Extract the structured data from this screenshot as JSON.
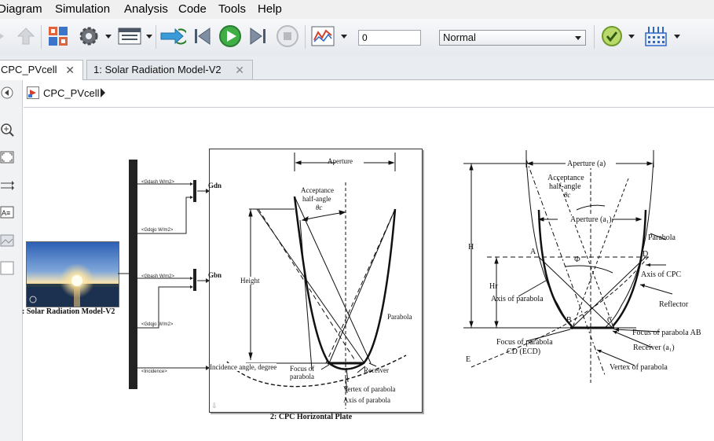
{
  "menubar": {
    "items": [
      "Diagram",
      "Simulation",
      "Analysis",
      "Code",
      "Tools",
      "Help"
    ]
  },
  "toolbar": {
    "stop_time": "0",
    "sim_mode": "Normal"
  },
  "tabs": [
    {
      "label": "CPC_PVcell",
      "active": true
    },
    {
      "label": "1: Solar Radiation Model-V2",
      "active": false
    }
  ],
  "breadcrumb": {
    "label": "CPC_PVcell"
  },
  "diagram": {
    "source_block_label": ": Solar Radiation Model-V2",
    "bus_signals": [
      "<Gdash W/m2>",
      "<Gdqjo W/m2>",
      "<Gbash W/m2>",
      "<Gdqjo W/m2>",
      "<Incidence>"
    ],
    "outputs": [
      "Gdn",
      "Gbn",
      "Incidence angle, degree"
    ],
    "cpc_block_label": "2: CPC Horizontal Plate",
    "figure1": {
      "aperture": "Aperture",
      "acceptance1": "Acceptance",
      "acceptance2": "half-angle",
      "theta": "θc",
      "height": "Height",
      "parabola": "Parabola",
      "focus1": "Focus of",
      "focus2": "parabola",
      "receiver": "Receiver",
      "vertex": "Vertex of parabola",
      "axis": "Axis of parabola"
    },
    "figure2": {
      "aperture_a": "Aperture (a)",
      "acceptance1": "Acceptance",
      "acceptance2": "half-angle",
      "theta": "θc",
      "aperture_a1": "Aperture (a₁)",
      "parabola": "Parabola",
      "H": "H",
      "Hr": "Hr",
      "A": "A",
      "D": "D",
      "B": "B",
      "C": "C",
      "E": "E",
      "phi": "Φ",
      "axis_cpc": "Axis of CPC",
      "axis_parabola": "Axis of parabola",
      "reflector": "Reflector",
      "focus_ab": "Focus of parabola AB",
      "focus_cd1": "Focus of parabola",
      "focus_cd2": "CD (ECD)",
      "receiver": "Receiver (a₁)",
      "vertex": "Vertex of parabola"
    }
  }
}
